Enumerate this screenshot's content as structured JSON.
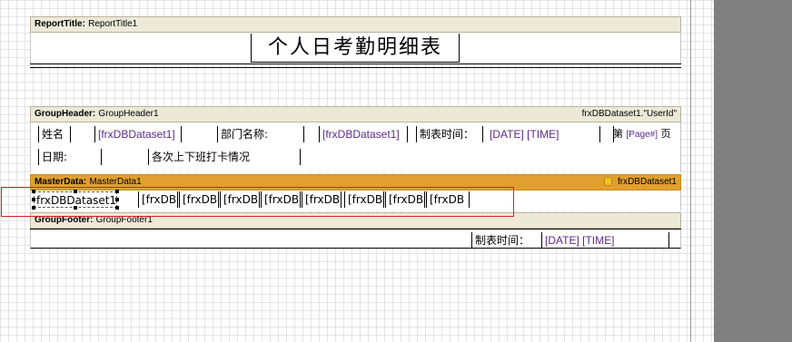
{
  "bands": {
    "report_title": {
      "type_label": "ReportTitle:",
      "name": "ReportTitle1",
      "title_text": "个人日考勤明细表"
    },
    "group_header": {
      "type_label": "GroupHeader:",
      "name": "GroupHeader1",
      "condition": "frxDBDataset1.\"UserId\"",
      "fields": {
        "name_label": "姓名",
        "name_value": "[frxDBDataset1]",
        "dept_label": "部门名称:",
        "dept_value": "[frxDBDataset1]",
        "made_time_label": "制表时间：",
        "made_time_value": "[DATE] [TIME]",
        "page_prefix": "第",
        "page_macro": "[Page#]",
        "page_suffix": "页",
        "date_label": "日期:",
        "punch_label": "各次上下班打卡情况"
      }
    },
    "master_data": {
      "type_label": "MasterData:",
      "name": "MasterData1",
      "dataset": "frxDBDataset1",
      "fields": [
        "frxDBDataset1",
        "[frxDB",
        "[frxDB",
        "[frxDB",
        "[frxDB",
        "[frxDB",
        "[frxDB",
        "[frxDB",
        "[frxDB"
      ]
    },
    "group_footer": {
      "type_label": "GroupFooter:",
      "name": "GroupFooter1",
      "made_time_label": "制表时间：",
      "made_time_value": "[DATE] [TIME]"
    }
  },
  "icons": {
    "dataset": "database-icon"
  },
  "colors": {
    "band_header": "#ece9d8",
    "master_band": "#e0a030",
    "selection": "#d82020",
    "macro_text": "#5a2a8a",
    "gutter": "#808080"
  }
}
